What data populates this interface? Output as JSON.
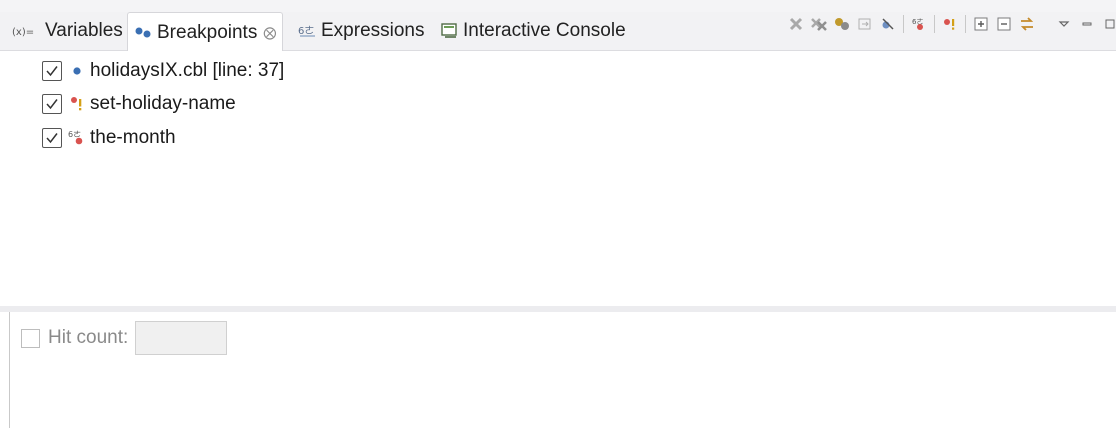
{
  "tabs": [
    {
      "label": "Variables",
      "icon": "variables-icon",
      "active": false
    },
    {
      "label": "Breakpoints",
      "icon": "breakpoints-icon",
      "active": true
    },
    {
      "label": "Expressions",
      "icon": "expressions-icon",
      "active": false
    },
    {
      "label": "Interactive Console",
      "icon": "console-icon",
      "active": false
    }
  ],
  "toolbar": [
    "remove-breakpoint-icon",
    "remove-all-breakpoints-icon",
    "show-breakpoints-icon",
    "go-to-file-icon",
    "skip-all-breakpoints-icon",
    "add-watchpoint-icon",
    "add-paragraph-breakpoint-icon",
    "expand-all-icon",
    "collapse-all-icon",
    "link-with-debug-view-icon",
    "view-menu-icon",
    "minimize-icon",
    "maximize-icon"
  ],
  "breakpoints": [
    {
      "label": "holidaysIX.cbl [line: 37]",
      "checked": true,
      "icon": "line-breakpoint-icon"
    },
    {
      "label": "set-holiday-name",
      "checked": true,
      "icon": "paragraph-breakpoint-icon"
    },
    {
      "label": "the-month",
      "checked": true,
      "icon": "watchpoint-icon"
    }
  ],
  "details": {
    "hit_count_label": "Hit count:",
    "hit_count_checked": false,
    "hit_count_value": ""
  },
  "colors": {
    "breakpoint_blue": "#3a6fb3",
    "breakpoint_red": "#d9534f",
    "paragraph_yellow": "#d4a017"
  }
}
